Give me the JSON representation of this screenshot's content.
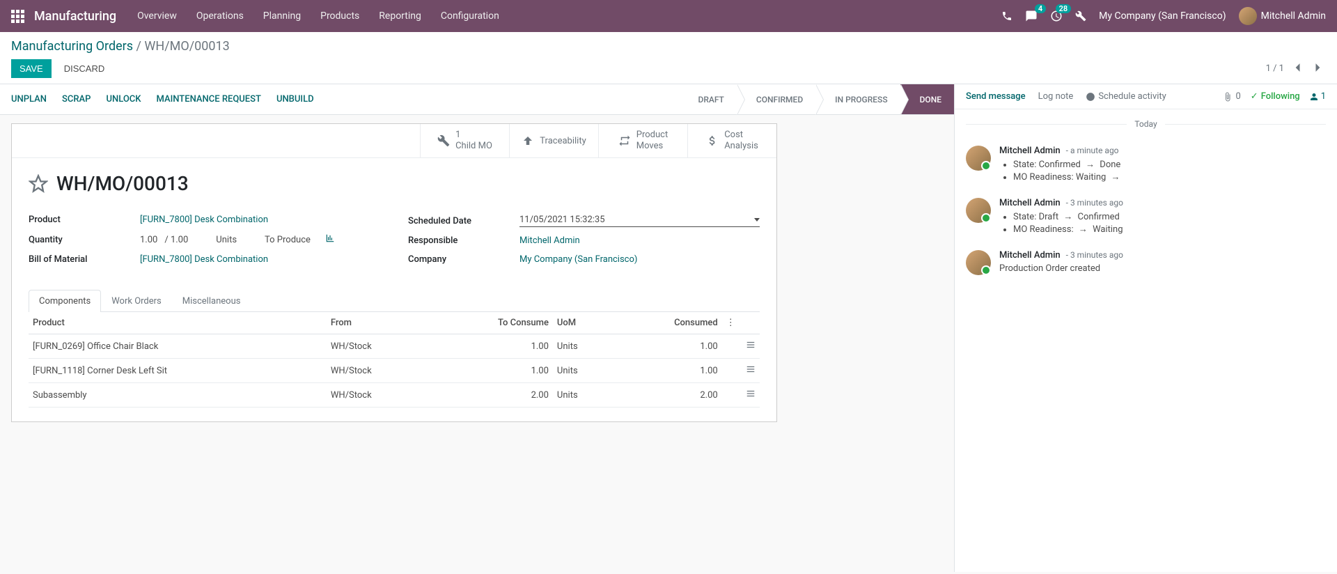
{
  "nav": {
    "brand": "Manufacturing",
    "menu": [
      "Overview",
      "Operations",
      "Planning",
      "Products",
      "Reporting",
      "Configuration"
    ],
    "messaging_badge": "4",
    "activities_badge": "28",
    "company": "My Company (San Francisco)",
    "user": "Mitchell Admin"
  },
  "breadcrumb": {
    "root": "Manufacturing Orders",
    "current": "WH/MO/00013"
  },
  "buttons": {
    "save": "SAVE",
    "discard": "DISCARD"
  },
  "pager": {
    "value": "1 / 1"
  },
  "status_buttons": [
    "UNPLAN",
    "SCRAP",
    "UNLOCK",
    "MAINTENANCE REQUEST",
    "UNBUILD"
  ],
  "status_steps": [
    "DRAFT",
    "CONFIRMED",
    "IN PROGRESS",
    "DONE"
  ],
  "stat_buttons": {
    "child_mo": {
      "count": "1",
      "label": "Child MO"
    },
    "traceability": "Traceability",
    "moves": {
      "l1": "Product",
      "l2": "Moves"
    },
    "cost": {
      "l1": "Cost",
      "l2": "Analysis"
    }
  },
  "record": {
    "name": "WH/MO/00013",
    "labels": {
      "product": "Product",
      "quantity": "Quantity",
      "bom": "Bill of Material",
      "scheduled": "Scheduled Date",
      "responsible": "Responsible",
      "company": "Company"
    },
    "product": "[FURN_7800] Desk Combination",
    "qty": "1.00",
    "qty_of": "/ 1.00",
    "uom": "Units",
    "to_produce": "To Produce",
    "bom": "[FURN_7800] Desk Combination",
    "scheduled": "11/05/2021 15:32:35",
    "responsible": "Mitchell Admin",
    "company": "My Company (San Francisco)"
  },
  "tabs": [
    "Components",
    "Work Orders",
    "Miscellaneous"
  ],
  "table": {
    "headers": {
      "product": "Product",
      "from": "From",
      "to_consume": "To Consume",
      "uom": "UoM",
      "consumed": "Consumed"
    },
    "rows": [
      {
        "product": "[FURN_0269] Office Chair Black",
        "from": "WH/Stock",
        "to_consume": "1.00",
        "uom": "Units",
        "consumed": "1.00"
      },
      {
        "product": "[FURN_1118] Corner Desk Left Sit",
        "from": "WH/Stock",
        "to_consume": "1.00",
        "uom": "Units",
        "consumed": "1.00"
      },
      {
        "product": "Subassembly",
        "from": "WH/Stock",
        "to_consume": "2.00",
        "uom": "Units",
        "consumed": "2.00"
      }
    ]
  },
  "chatter": {
    "send": "Send message",
    "log": "Log note",
    "schedule": "Schedule activity",
    "attachments": "0",
    "following": "Following",
    "followers": "1",
    "today": "Today",
    "messages": [
      {
        "author": "Mitchell Admin",
        "time": "- a minute ago",
        "lines": [
          "State: Confirmed → Done",
          "MO Readiness: Waiting →"
        ]
      },
      {
        "author": "Mitchell Admin",
        "time": "- 3 minutes ago",
        "lines": [
          "State: Draft → Confirmed",
          "MO Readiness: → Waiting"
        ]
      },
      {
        "author": "Mitchell Admin",
        "time": "- 3 minutes ago",
        "text": "Production Order created"
      }
    ]
  }
}
